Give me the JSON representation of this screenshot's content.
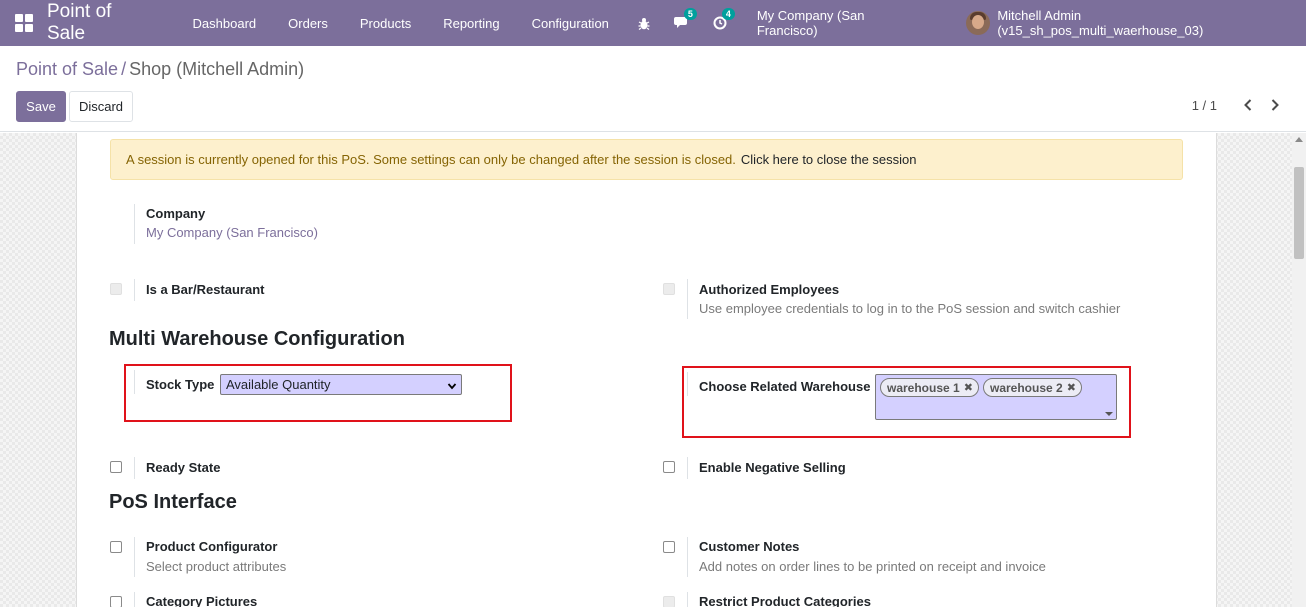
{
  "navbar": {
    "brand": "Point of Sale",
    "menu": [
      "Dashboard",
      "Orders",
      "Products",
      "Reporting",
      "Configuration"
    ],
    "messages_count": "5",
    "activities_count": "4",
    "company": "My Company (San Francisco)",
    "user": "Mitchell Admin (v15_sh_pos_multi_waerhouse_03)"
  },
  "breadcrumb": {
    "parent": "Point of Sale",
    "separator": "/",
    "current": "Shop (Mitchell Admin)"
  },
  "actions": {
    "save": "Save",
    "discard": "Discard"
  },
  "pager": {
    "value": "1 / 1"
  },
  "alert": {
    "message": "A session is currently opened for this PoS. Some settings can only be changed after the session is closed.",
    "link": "Click here to close the session"
  },
  "form": {
    "company_label": "Company",
    "company_value": "My Company (San Francisco)",
    "bar_restaurant_label": "Is a Bar/Restaurant",
    "authorized_employees_label": "Authorized Employees",
    "authorized_employees_help": "Use employee credentials to log in to the PoS session and switch cashier",
    "multi_warehouse_title": "Multi Warehouse Configuration",
    "stock_type_label": "Stock Type",
    "stock_type_value": "Available Quantity",
    "related_warehouse_label": "Choose Related Warehouse",
    "warehouse_tags": [
      "warehouse 1",
      "warehouse 2"
    ],
    "ready_state_label": "Ready State",
    "negative_selling_label": "Enable Negative Selling",
    "pos_interface_title": "PoS Interface",
    "product_configurator_label": "Product Configurator",
    "product_configurator_help": "Select product attributes",
    "customer_notes_label": "Customer Notes",
    "customer_notes_help": "Add notes on order lines to be printed on receipt and invoice",
    "category_pictures_label": "Category Pictures",
    "restrict_categories_label": "Restrict Product Categories"
  },
  "colors": {
    "navbar": "#7c6f9b",
    "primary": "#7c6f9b",
    "alert_bg": "#fdf0cd",
    "highlight_border": "#e0121a",
    "select_bg": "#d4d0ff"
  }
}
